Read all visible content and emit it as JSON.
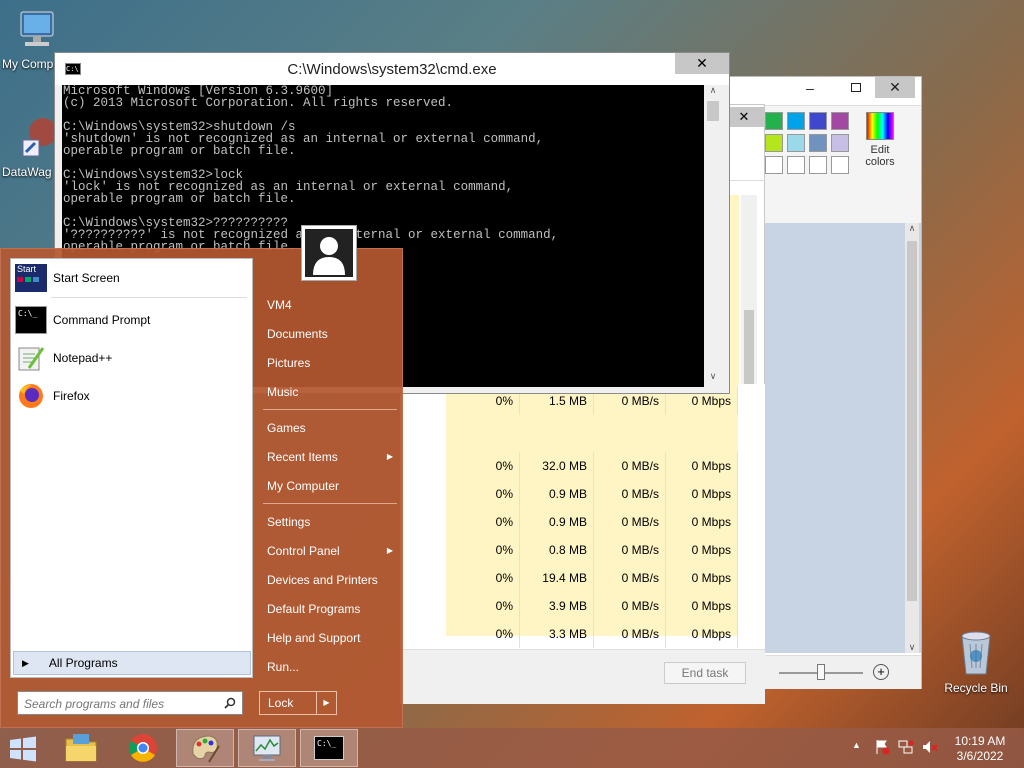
{
  "desktop": {
    "icons": [
      {
        "label": "My Comp"
      },
      {
        "label": "DataWag"
      },
      {
        "label": "Recycle Bin"
      }
    ]
  },
  "cmd": {
    "title": "C:\\Windows\\system32\\cmd.exe",
    "lines": [
      "Microsoft Windows [Version 6.3.9600]",
      "(c) 2013 Microsoft Corporation. All rights reserved.",
      "",
      "C:\\Windows\\system32>shutdown /s",
      "'shutdown' is not recognized as an internal or external command,",
      "operable program or batch file.",
      "",
      "C:\\Windows\\system32>lock",
      "'lock' is not recognized as an internal or external command,",
      "operable program or batch file.",
      "",
      "C:\\Windows\\system32>??????????",
      "'??????????' is not recognized as an internal or external command,",
      "operable program or batch file."
    ]
  },
  "paint": {
    "edit_colors": "Edit colors"
  },
  "taskmgr": {
    "rows": [
      {
        "cpu": "0%",
        "mem": "1.5 MB",
        "disk": "0 MB/s",
        "net": "0 Mbps"
      },
      {
        "cpu": "0%",
        "mem": "32.0 MB",
        "disk": "0 MB/s",
        "net": "0 Mbps"
      },
      {
        "cpu": "0%",
        "mem": "0.9 MB",
        "disk": "0 MB/s",
        "net": "0 Mbps"
      },
      {
        "cpu": "0%",
        "mem": "0.9 MB",
        "disk": "0 MB/s",
        "net": "0 Mbps"
      },
      {
        "cpu": "0%",
        "mem": "0.8 MB",
        "disk": "0 MB/s",
        "net": "0 Mbps"
      },
      {
        "cpu": "0%",
        "mem": "19.4 MB",
        "disk": "0 MB/s",
        "net": "0 Mbps"
      },
      {
        "cpu": "0%",
        "mem": "3.9 MB",
        "disk": "0 MB/s",
        "net": "0 Mbps"
      },
      {
        "cpu": "0%",
        "mem": "3.3 MB",
        "disk": "0 MB/s",
        "net": "0 Mbps"
      }
    ],
    "end_task": "End task"
  },
  "start_menu": {
    "pinned": [
      {
        "label": "Start Screen",
        "icon": "start-screen-icon"
      },
      {
        "label": "Command Prompt",
        "icon": "command-prompt-icon"
      },
      {
        "label": "Notepad++",
        "icon": "notepad-plus-plus-icon"
      },
      {
        "label": "Firefox",
        "icon": "firefox-icon"
      }
    ],
    "all_programs": "All Programs",
    "search_placeholder": "Search programs and files",
    "right": [
      {
        "label": "VM4"
      },
      {
        "label": "Documents"
      },
      {
        "label": "Pictures"
      },
      {
        "label": "Music"
      },
      {
        "label": "Games"
      },
      {
        "label": "Recent Items",
        "submenu": true
      },
      {
        "label": "My Computer"
      },
      {
        "label": "Settings"
      },
      {
        "label": "Control Panel",
        "submenu": true
      },
      {
        "label": "Devices and Printers"
      },
      {
        "label": "Default Programs"
      },
      {
        "label": "Help and Support"
      },
      {
        "label": "Run..."
      }
    ],
    "lock": "Lock"
  },
  "taskbar": {
    "time": "10:19 AM",
    "date": "3/6/2022"
  },
  "colors": {
    "start_menu_bg": "#b45830",
    "console_bg": "#000000",
    "console_fg": "#c0c0c0",
    "taskmgr_highlight": "#fff4c4"
  }
}
